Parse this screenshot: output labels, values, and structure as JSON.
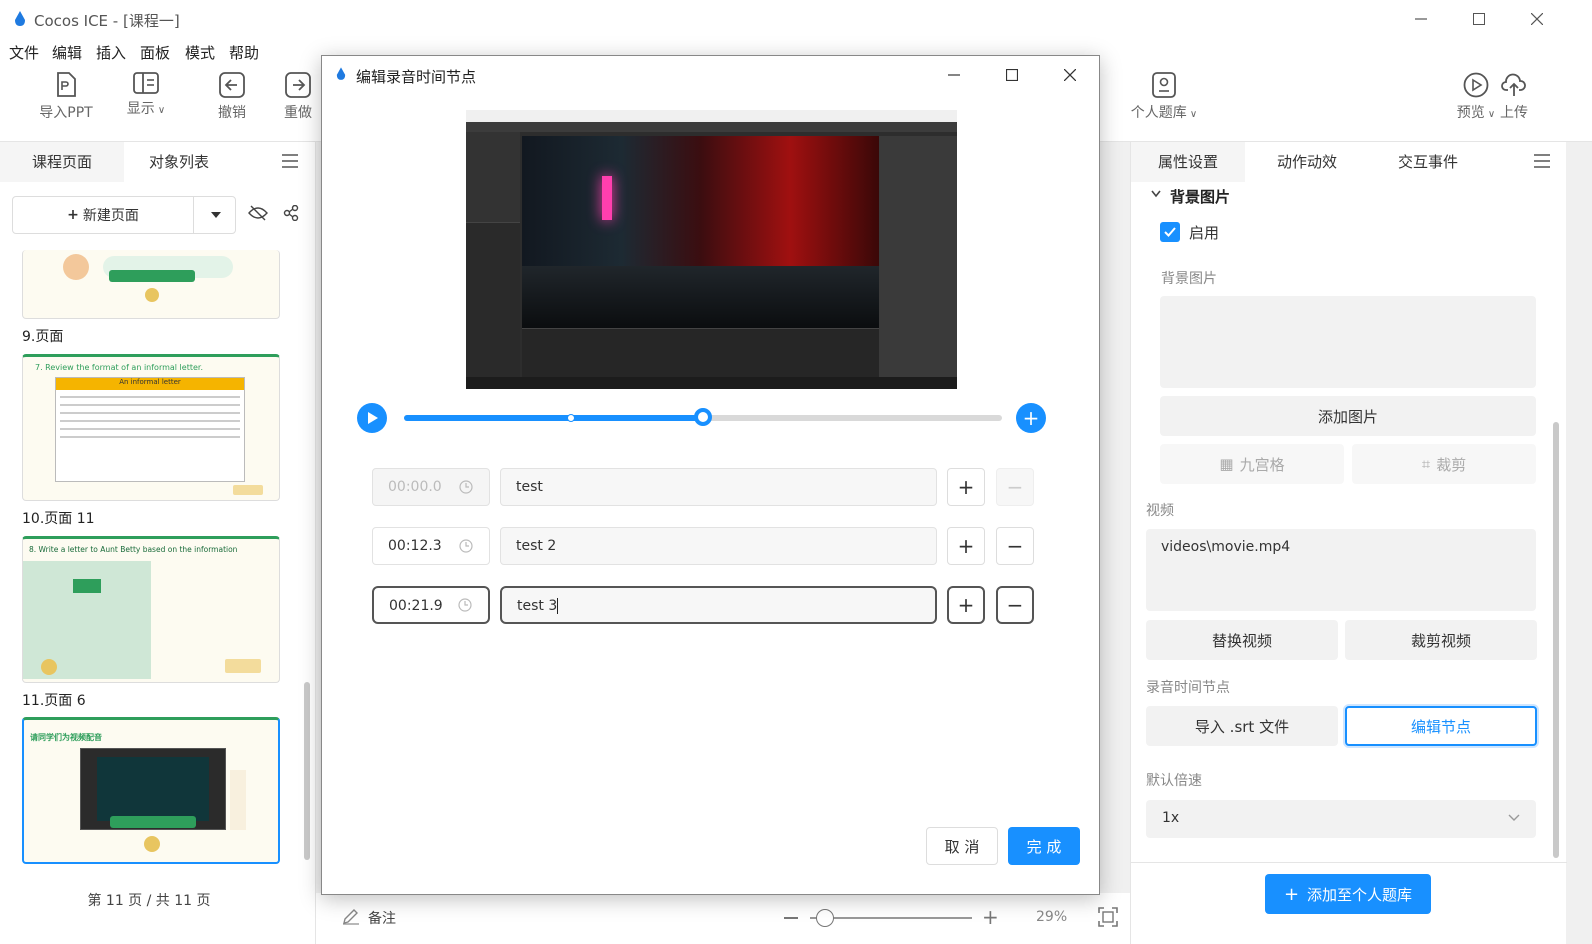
{
  "app": {
    "title": "Cocos ICE - [课程一]",
    "menu": [
      "文件",
      "编辑",
      "插入",
      "面板",
      "模式",
      "帮助"
    ]
  },
  "toolbar": {
    "import_ppt": "导入PPT",
    "display": "显示",
    "undo": "撤销",
    "redo": "重做",
    "personal_bank": "个人题库",
    "preview": "预览",
    "upload": "上传"
  },
  "left": {
    "tab_pages": "课程页面",
    "tab_objects": "对象列表",
    "new_page": "新建页面",
    "pages": [
      {
        "label": "9.页面"
      },
      {
        "label": "10.页面 11",
        "heading": "7. Review the format of an informal letter.",
        "banner": "An informal letter"
      },
      {
        "label": "11.页面 6",
        "heading": "8. Write a letter to Aunt Betty based on the information"
      },
      {
        "heading": "请同学们为视频配音"
      }
    ],
    "footer": "第 11 页 / 共 11 页"
  },
  "modal": {
    "title": "编辑录音时间节点",
    "rows": [
      {
        "time": "00:00.0",
        "text": "test",
        "disabled": true
      },
      {
        "time": "00:12.3",
        "text": "test 2",
        "disabled": false
      },
      {
        "time": "00:21.9",
        "text": "test 3",
        "disabled": false
      }
    ],
    "cancel": "取 消",
    "done": "完 成",
    "progress_fraction": 0.5
  },
  "right": {
    "tab_props": "属性设置",
    "tab_anim": "动作动效",
    "tab_events": "交互事件",
    "section_bg": "背景图片",
    "enable": "启用",
    "bg_label": "背景图片",
    "add_image": "添加图片",
    "nine_grid": "九宫格",
    "crop": "裁剪",
    "video_label": "视频",
    "video_path": "videos\\movie.mp4",
    "replace_video": "替换视频",
    "crop_video": "裁剪视频",
    "rec_label": "录音时间节点",
    "import_srt": "导入 .srt 文件",
    "edit_nodes": "编辑节点",
    "speed_label": "默认倍速",
    "speed_value": "1x",
    "add_to_bank": "添加至个人题库"
  },
  "bottom": {
    "note": "备注",
    "zoom": "29%"
  },
  "colors": {
    "accent": "#1890ff",
    "green": "#2e9e5b"
  }
}
